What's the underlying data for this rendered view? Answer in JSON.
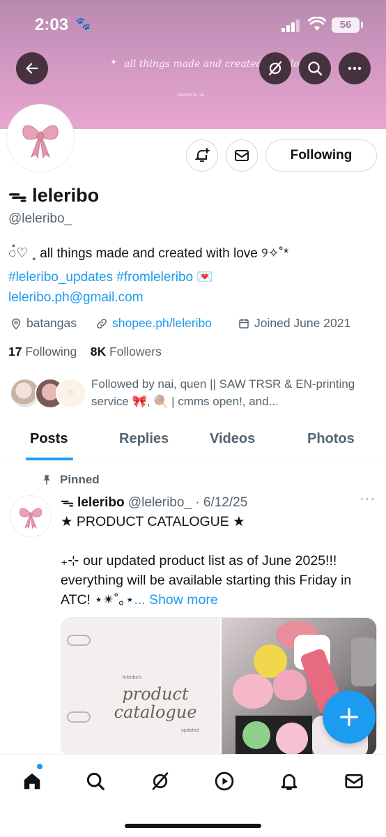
{
  "status_bar": {
    "time": "2:03",
    "battery": "56"
  },
  "banner": {
    "text": "all things made and created with love",
    "small_text": "leleribo by nai"
  },
  "profile": {
    "name": "ᯓ leleribo",
    "handle": "@leleribo_",
    "bio_line1": "◌̊♡ ˳ all things made and created with love ୨✧˚*",
    "bio_hashtags": "#leleribo_updates #fromleleribo 💌",
    "bio_email": "leleribo.ph@gmail.com",
    "location": "batangas",
    "website": "shopee.ph/leleribo",
    "joined": "Joined June 2021",
    "following_count": "17",
    "following_label": "Following",
    "followers_count": "8K",
    "followers_label": "Followers",
    "followed_by": "Followed by nai, quen || SAW TRSR & EN-printing service 🎀, 🍭 | cmms open!, and..."
  },
  "actions": {
    "follow_label": "Following"
  },
  "tabs": [
    {
      "label": "Posts"
    },
    {
      "label": "Replies"
    },
    {
      "label": "Videos"
    },
    {
      "label": "Photos"
    }
  ],
  "post": {
    "pinned_label": "Pinned",
    "author": "ᯓ leleribo",
    "handle": "@leleribo_",
    "date": "· 6/12/25",
    "title": "★ PRODUCT CATALOGUE ★",
    "body": "₊⊹ our updated product list as of June 2025!!! everything will be available starting this Friday in ATC! ⋆✴︎˚｡⋆",
    "show_more": "... Show more",
    "media_left_title": "product catalogue",
    "media_left_caption": "leleribo's",
    "media_left_sub": "updated"
  },
  "colors": {
    "accent": "#1d9bf0",
    "banner": "#cf97c1"
  },
  "icons": {
    "back": "back-arrow-icon",
    "grok": "grok-icon",
    "search": "search-icon",
    "more": "more-icon",
    "notify": "bell-plus-icon",
    "message": "envelope-icon"
  }
}
